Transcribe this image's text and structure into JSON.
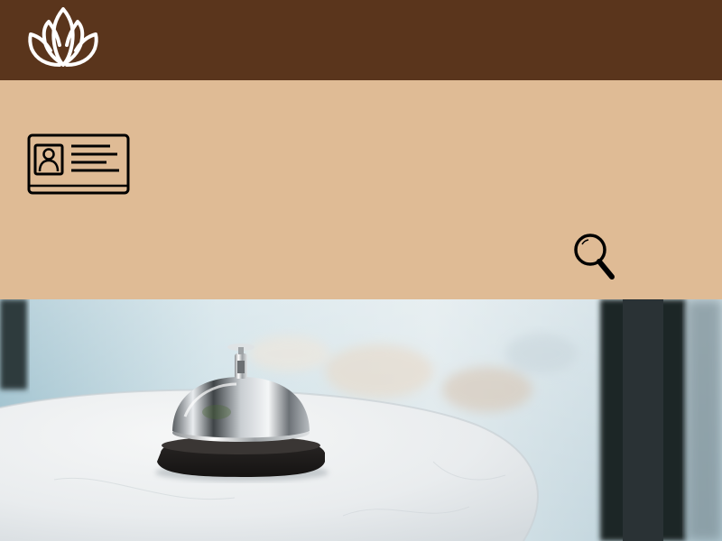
{
  "header": {
    "logo_icon": "lotus-icon",
    "background_color": "#5a351c"
  },
  "panel": {
    "background_color": "#dfbb95",
    "id_card_icon": "id-card-icon",
    "search_icon": "search-icon"
  },
  "hero": {
    "image": "service-bell-on-marble-table"
  }
}
